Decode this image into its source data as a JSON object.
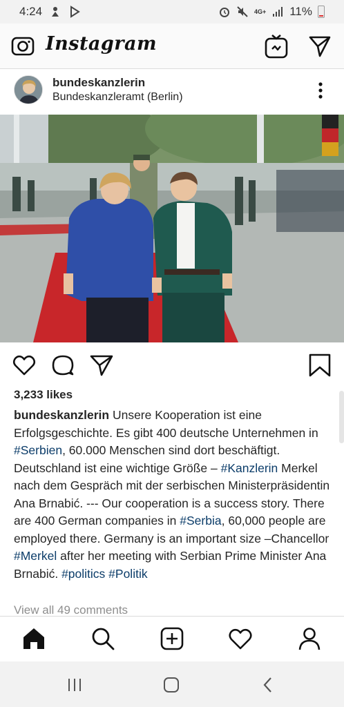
{
  "status_bar": {
    "time": "4:24",
    "network": "4G+",
    "battery": "11%"
  },
  "app_bar": {
    "logo": "Instagram",
    "icons": [
      "camera-icon",
      "igtv-icon",
      "direct-send-icon"
    ]
  },
  "post": {
    "username": "bundeskanzlerin",
    "location": "Bundeskanzleramt (Berlin)",
    "likes": "3,233 likes",
    "caption": {
      "user": "bundeskanzlerin",
      "t1": " Unsere Kooperation ist eine Erfolgsgeschichte. Es gibt 400 deutsche Unternehmen in ",
      "tag_serbien": "#Serbien",
      "t2": ", 60.000 Menschen sind dort beschäftigt. Deutschland ist eine wichtige Größe – ",
      "tag_kanzlerin": "#Kanzlerin",
      "t3": " Merkel nach dem Gespräch mit der serbischen Ministerpräsidentin Ana Brnabić. --- Our cooperation is a success story. There are 400 German companies in ",
      "tag_serbia": "#Serbia",
      "t4": ", 60,000 people are employed there. Germany is an important size –Chancellor ",
      "tag_merkel": "#Merkel",
      "t5": " after her meeting with Serbian Prime Minister Ana Brnabić. ",
      "tag_politics": "#politics",
      "t6": " ",
      "tag_politik": "#Politik"
    },
    "view_comments": "View all 49 comments"
  },
  "colors": {
    "hashtag": "#0b3c69",
    "text": "#262626",
    "muted": "#8e8e8e",
    "carpet": "#c8262a",
    "blazer_blue": "#2f4fa8",
    "suit_green": "#1f5a4f"
  }
}
